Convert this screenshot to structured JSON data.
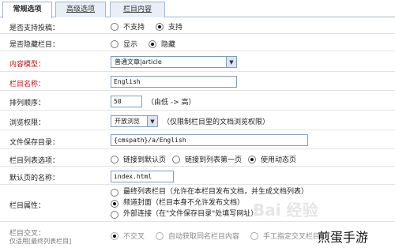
{
  "tabs": [
    {
      "label": "常规选项",
      "active": true
    },
    {
      "label": "高级选项",
      "active": false
    },
    {
      "label": "栏目内容",
      "active": false
    }
  ],
  "rows": {
    "allow_submit": {
      "label": "是否支持投稿：",
      "opt_no": "不支持",
      "opt_yes": "支持",
      "selected": "yes"
    },
    "hide_column": {
      "label": "是否隐藏栏目：",
      "opt_show": "显示",
      "opt_hide": "隐藏",
      "selected": "hide"
    },
    "content_model": {
      "label": "内容模型：",
      "value": "普通文章|article"
    },
    "column_name": {
      "label": "栏目名称：",
      "value": "English"
    },
    "sort_order": {
      "label": "排列顺序：",
      "value": "50",
      "hint": "（由低 -> 高）"
    },
    "browse_perm": {
      "label": "浏览权限：",
      "value": "开放浏览",
      "hint": "（仅限制栏目里的文档浏览权限）"
    },
    "save_dir": {
      "label": "文件保存目录：",
      "value": "{cmspath}/a/English"
    },
    "list_option": {
      "label": "栏目列表选项：",
      "opt1": "链接到默认页",
      "opt2": "链接到列表第一页",
      "opt3": "使用动态页",
      "selected": "opt3"
    },
    "default_page": {
      "label": "默认页的名称：",
      "value": "index.html"
    },
    "column_attr": {
      "label": "栏目属性：",
      "opt1": "最终列表栏目（允许在本栏目发布文档，并生成文档列表）",
      "opt2": "频道封面（栏目本身不允许发布文档）",
      "opt3": "外部连接（在\"文件保存目录\"处填写网址）",
      "selected": "opt2"
    },
    "cross": {
      "label": "栏目交叉：",
      "sublabel": "仅适用[最终列表栏目]",
      "opt1": "不交叉",
      "opt2": "自动获取同名栏目内容",
      "opt3": "手工指定交叉栏目ID",
      "selected": "opt1"
    }
  },
  "watermark": {
    "baidu": "Bai 经验",
    "site": "煎蛋手游"
  }
}
